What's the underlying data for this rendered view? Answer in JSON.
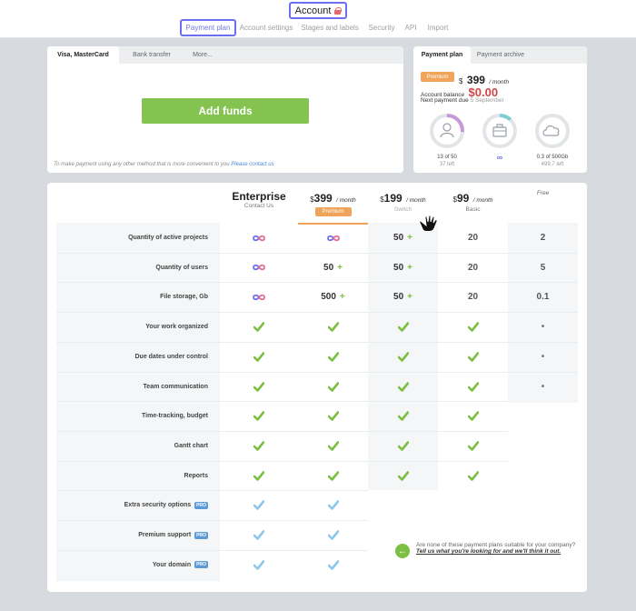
{
  "header": {
    "title": "Account",
    "tabs": [
      {
        "label": "Payment plan",
        "active": true
      },
      {
        "label": "Account settings"
      },
      {
        "label": "Stages and labels"
      },
      {
        "label": "Security"
      },
      {
        "label": "API"
      },
      {
        "label": "Import"
      }
    ]
  },
  "payment": {
    "tabs": [
      "Visa, MasterCard",
      "Bank transfer",
      "More..."
    ],
    "add_funds": "Add funds",
    "note": "To make payment using any other method that is more convenient to you",
    "note_link": "Please contact us"
  },
  "plan_info": {
    "tabs": [
      "Payment plan",
      "Payment archive"
    ],
    "badge": "Premium",
    "currency": "$",
    "price": "399",
    "per_month": "/ month",
    "balance_label": "Account balance",
    "balance_value": "$0.00",
    "next_payment_label": "Next payment due",
    "next_payment_date": "5 September",
    "gauges": [
      {
        "name": "users",
        "label": "13 of 50",
        "sub": "37 left",
        "fraction": 0.26,
        "color": "#c59ad6"
      },
      {
        "name": "projects",
        "label": "∞",
        "sub": "",
        "fraction": 0.12,
        "color": "#7ecfcf"
      },
      {
        "name": "storage",
        "label": "0.3 of 500Gb",
        "sub": "499.7 left",
        "fraction": 0.0,
        "color": "#cfd4d8"
      }
    ]
  },
  "plans": {
    "columns": [
      {
        "name": "Enterprise",
        "sub": "Contact Us"
      },
      {
        "currency": "$",
        "price": "399",
        "per": "/ month",
        "badge": "Premium"
      },
      {
        "currency": "$",
        "price": "199",
        "per": "/ month",
        "sub": "Switch"
      },
      {
        "currency": "$",
        "price": "99",
        "per": "/ month",
        "sub": "Basic"
      },
      {
        "free": "Free"
      }
    ],
    "rows": [
      {
        "label": "Quantity of active projects",
        "values": [
          "∞",
          "∞",
          "50 +",
          "20",
          "2"
        ]
      },
      {
        "label": "Quantity of users",
        "values": [
          "∞",
          "50 +",
          "50 +",
          "20",
          "5"
        ]
      },
      {
        "label": "File storage, Gb",
        "values": [
          "∞",
          "500 +",
          "50 +",
          "20",
          "0.1"
        ]
      },
      {
        "label": "Your work organized",
        "values": [
          "✔",
          "✔",
          "✔",
          "✔",
          "•"
        ]
      },
      {
        "label": "Due dates under control",
        "values": [
          "✔",
          "✔",
          "✔",
          "✔",
          "•"
        ]
      },
      {
        "label": "Team communication",
        "values": [
          "✔",
          "✔",
          "✔",
          "✔",
          "•"
        ]
      },
      {
        "label": "Time-tracking, budget",
        "values": [
          "✔",
          "✔",
          "✔",
          "✔",
          ""
        ]
      },
      {
        "label": "Gantt chart",
        "values": [
          "✔",
          "✔",
          "✔",
          "✔",
          ""
        ]
      },
      {
        "label": "Reports",
        "values": [
          "✔",
          "✔",
          "✔",
          "✔",
          ""
        ]
      },
      {
        "label": "Extra security options",
        "pro": "PRO",
        "values": [
          "✔b",
          "✔b",
          "",
          "",
          ""
        ]
      },
      {
        "label": "Premium support",
        "pro": "PRO",
        "values": [
          "✔b",
          "✔b",
          "",
          "",
          ""
        ]
      },
      {
        "label": "Your domain",
        "pro": "PRO",
        "values": [
          "✔b",
          "✔b",
          "",
          "",
          ""
        ]
      }
    ],
    "tell_text": "Are none of these payment plans suitable for your company?",
    "tell_link": "Tell us what you're looking for and we'll think it out."
  }
}
